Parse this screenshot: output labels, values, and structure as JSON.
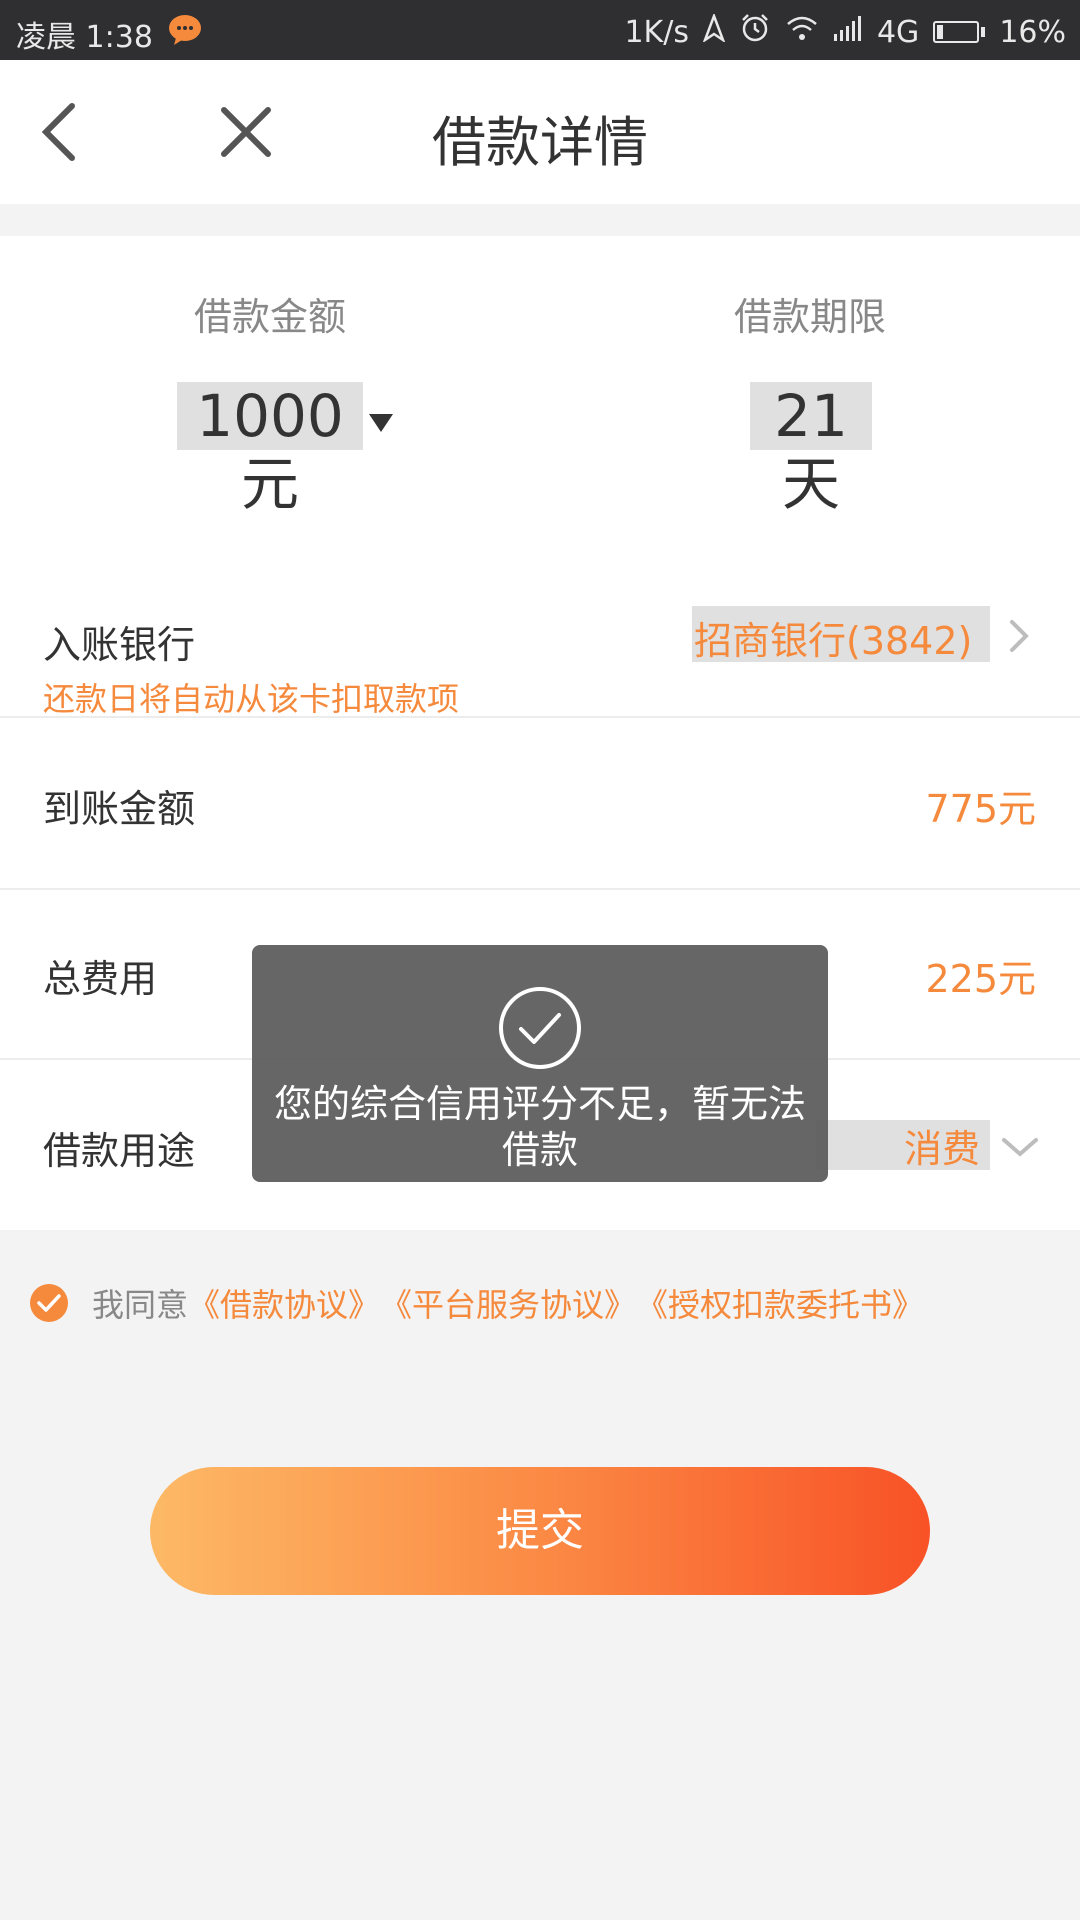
{
  "status_bar": {
    "time": "凌晨 1:38",
    "network_speed": "1K/s",
    "signal": "4G",
    "battery": "16%",
    "battery_level": 0.16
  },
  "header": {
    "title": "借款详情"
  },
  "summary": {
    "amount_label": "借款金额",
    "amount_value": "1000元",
    "term_label": "借款期限",
    "term_value": "21天"
  },
  "form": {
    "bank_label": "入账银行",
    "bank_value": "招商银行(3842)",
    "bank_note": "还款日将自动从该卡扣取款项",
    "receive_label": "到账金额",
    "receive_value": "775元",
    "fee_label": "总费用",
    "fee_value": "225元",
    "purpose_label": "借款用途",
    "purpose_value": "消费"
  },
  "agreement": {
    "prefix": "我同意",
    "links": [
      "《借款协议》",
      "《平台服务协议》",
      "《授权扣款委托书》"
    ]
  },
  "submit_label": "提交",
  "toast": {
    "message": "您的综合信用评分不足，暂无法借款"
  },
  "colors": {
    "accent": "#f5893c",
    "gradient_start": "#fdb966",
    "gradient_end": "#f85226"
  }
}
